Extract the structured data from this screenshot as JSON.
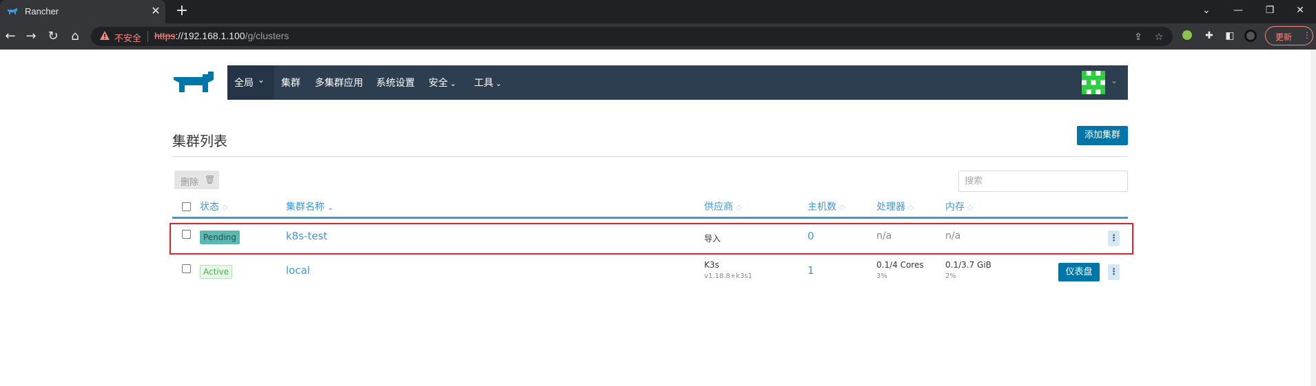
{
  "browser": {
    "tab_title": "Rancher",
    "tab_close": "✕",
    "new_tab": "+",
    "insecure_label": "不安全",
    "url_scheme": "https",
    "url_host": "://192.168.1.100",
    "url_path": "/g/clusters",
    "update_label": "更新",
    "window_controls": [
      "⌄",
      "—",
      "❐",
      "✕"
    ]
  },
  "nav": {
    "global_label": "全局",
    "items": [
      "集群",
      "多集群应用",
      "系统设置",
      "安全",
      "工具"
    ]
  },
  "page": {
    "title": "集群列表",
    "add_cluster_label": "添加集群",
    "delete_label": "删除",
    "search_placeholder": "搜索"
  },
  "table": {
    "headers": {
      "state": "状态",
      "name": "集群名称",
      "provider": "供应商",
      "hosts": "主机数",
      "cpu": "处理器",
      "memory": "内存"
    },
    "rows": [
      {
        "state": "Pending",
        "name": "k8s-test",
        "provider": "导入",
        "provider_version": "",
        "hosts": "0",
        "cpu": "n/a",
        "cpu_pct": "",
        "memory": "n/a",
        "memory_pct": ""
      },
      {
        "state": "Active",
        "name": "local",
        "provider": "K3s",
        "provider_version": "v1.18.8+k3s1",
        "hosts": "1",
        "cpu": "0.1/4 Cores",
        "cpu_pct": "3%",
        "memory": "0.1/3.7 GiB",
        "memory_pct": "2%",
        "dashboard_label": "仪表盘"
      }
    ]
  },
  "colors": {
    "nav_bg": "#2c3e50",
    "primary": "#0075a8",
    "link": "#3d98d3",
    "highlight_border": "#e0212b"
  }
}
